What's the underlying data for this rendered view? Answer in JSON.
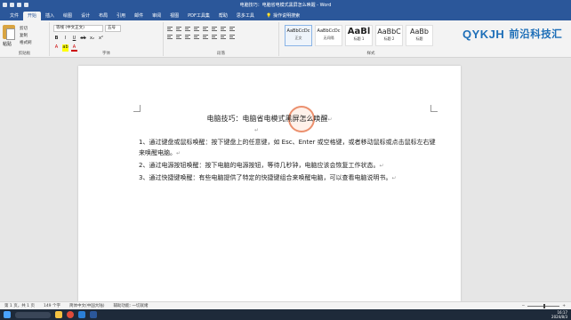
{
  "window": {
    "title": "电脑技巧：电脑省电模式黑屏怎么唤醒 - Word"
  },
  "tabs": [
    "文件",
    "开始",
    "插入",
    "绘图",
    "设计",
    "布局",
    "引用",
    "邮件",
    "审阅",
    "视图",
    "PDF工具集",
    "帮助",
    "思多工具"
  ],
  "tell_me": "操作说明搜索",
  "ribbon": {
    "clipboard": {
      "paste": "粘贴",
      "cut": "剪切",
      "copy": "复制",
      "format_painter": "格式刷",
      "label": "剪贴板"
    },
    "font": {
      "family": "等线 (中文正文)",
      "size": "五号",
      "label": "字体"
    },
    "paragraph": {
      "label": "段落"
    },
    "styles": {
      "label": "样式",
      "items": [
        {
          "sample": "AaBbCcDc",
          "name": "正文"
        },
        {
          "sample": "AaBbCcDc",
          "name": "无间隔"
        },
        {
          "sample": "AaBl",
          "name": "标题 1"
        },
        {
          "sample": "AaBbC",
          "name": "标题 2"
        },
        {
          "sample": "AaBb",
          "name": "标题"
        }
      ]
    }
  },
  "logo": {
    "mark": "QYKJH",
    "text": "前沿科技汇"
  },
  "document": {
    "heading": "电脑技巧：电脑省电模式黑屏怎么唤醒",
    "paragraphs": [
      "1、通过键盘或鼠标唤醒：按下键盘上的任意键，如 Esc、Enter 或空格键，或者移动鼠标或点击鼠标左右键来唤醒电脑。",
      "2、通过电源按钮唤醒：按下电脑的电源按钮，等待几秒钟，电脑应该会恢复工作状态。",
      "3、通过快捷键唤醒：有些电脑提供了特定的快捷键组合来唤醒电脑，可以查看电脑说明书。"
    ]
  },
  "status": {
    "page": "第 1 页，共 1 页",
    "words": "149 个字",
    "language": "简体中文(中国大陆)",
    "accessibility": "辅助功能: 一切就绪"
  },
  "taskbar": {
    "time": "16:17",
    "date": "2024/8/3"
  }
}
